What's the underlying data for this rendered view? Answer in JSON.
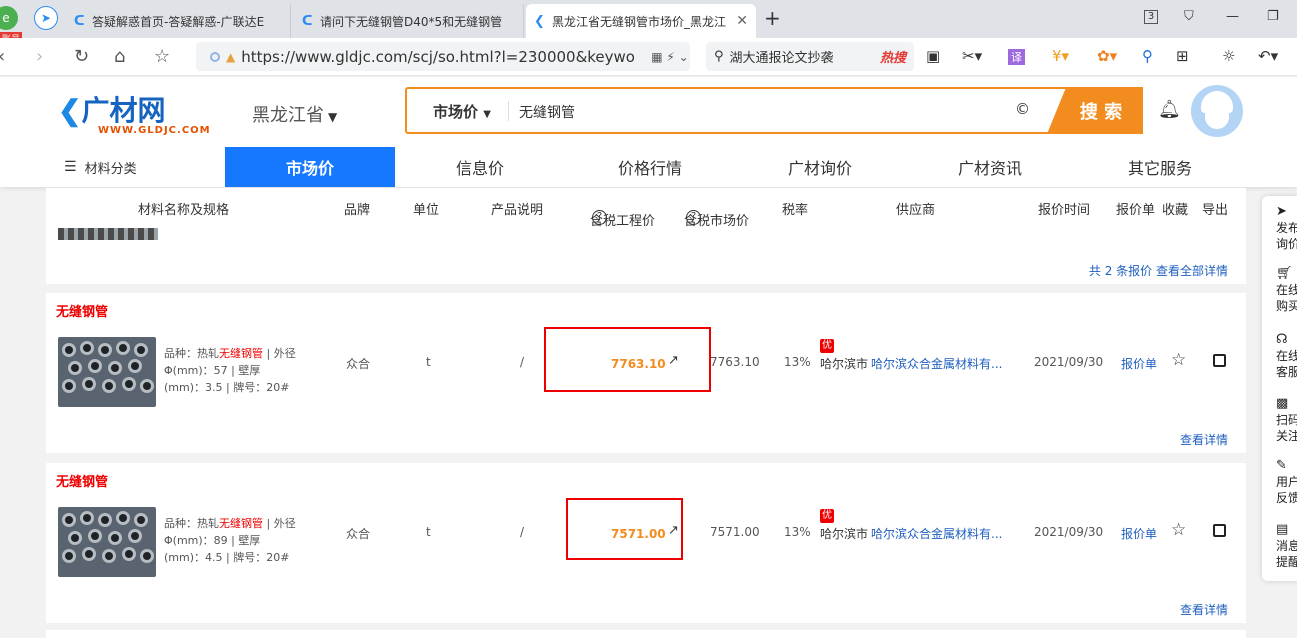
{
  "browser": {
    "left_badge": "账号",
    "tabs": [
      {
        "title": "答疑解惑首页-答疑解惑-广联达E",
        "active": false
      },
      {
        "title": "请问下无缝钢管D40*5和无缝钢管",
        "active": false
      },
      {
        "title": "黑龙江省无缝钢管市场价_黑龙江",
        "active": true
      }
    ],
    "tab_count": "3",
    "url": "https://www.gldjc.com/scj/so.html?l=230000&keywo",
    "search_text": "湖大通报论文抄袭",
    "search_hot": "热搜",
    "translate": "译"
  },
  "site": {
    "logo": "广材网",
    "logo_sub": "WWW.GLDJC.COM",
    "province": "黑龙江省",
    "search_type": "市场价",
    "search_query": "无缝钢管",
    "search_button": "搜 索",
    "nav": {
      "category": "材料分类",
      "items": [
        "市场价",
        "信息价",
        "价格行情",
        "广材询价",
        "广材资讯",
        "其它服务"
      ]
    }
  },
  "table": {
    "headers": {
      "name": "材料名称及规格",
      "brand": "品牌",
      "unit": "单位",
      "desc": "产品说明",
      "eng_price": "含税工程价",
      "market_price": "含税市场价",
      "tax": "税率",
      "supplier": "供应商",
      "time": "报价时间",
      "quote": "报价单",
      "fav": "收藏",
      "export": "导出"
    },
    "prev_summary": "共 2 条报价 查看全部详情",
    "rows": [
      {
        "title": "无缝钢管",
        "desc_prefix": "品种：热轧",
        "desc_highlight": "无缝钢管",
        "desc_suffix": " | 外径Φ(mm)：57 | 壁厚(mm)：3.5 | 牌号：20#",
        "brand": "众合",
        "unit": "t",
        "note": "/",
        "eng_price": "7763.10",
        "market_price": "7763.10",
        "tax": "13%",
        "badge": "优",
        "city": "哈尔滨市",
        "supplier": "哈尔滨众合金属材料有...",
        "date": "2021/09/30",
        "quote": "报价单",
        "detail": "查看详情"
      },
      {
        "title": "无缝钢管",
        "desc_prefix": "品种：热轧",
        "desc_highlight": "无缝钢管",
        "desc_suffix": " | 外径Φ(mm)：89 | 壁厚(mm)：4.5 | 牌号：20#",
        "brand": "众合",
        "unit": "t",
        "note": "/",
        "eng_price": "7571.00",
        "market_price": "7571.00",
        "tax": "13%",
        "badge": "优",
        "city": "哈尔滨市",
        "supplier": "哈尔滨众合金属材料有...",
        "date": "2021/09/30",
        "quote": "报价单",
        "detail": "查看详情"
      }
    ]
  },
  "side": {
    "items": [
      "发布询价",
      "在线购买",
      "在线客服",
      "扫码关注",
      "用户反馈",
      "消息提醒"
    ]
  },
  "colors": {
    "accent_orange": "#f28c1e",
    "nav_blue": "#1677ff",
    "highlight_red": "#e00"
  }
}
